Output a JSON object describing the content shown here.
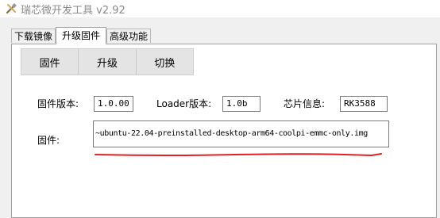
{
  "window": {
    "title": "瑞芯微开发工具 v2.92",
    "icon": "tools-icon"
  },
  "tabs": [
    {
      "label": "下载镜像",
      "active": false
    },
    {
      "label": "升级固件",
      "active": true
    },
    {
      "label": "高级功能",
      "active": false
    }
  ],
  "toolbar": {
    "firmware_label": "固件",
    "upgrade_label": "升级",
    "switch_label": "切换"
  },
  "info": {
    "fw_version_label": "固件版本:",
    "fw_version_value": "1.0.00",
    "loader_version_label": "Loader版本:",
    "loader_version_value": "1.0b",
    "chip_info_label": "芯片信息:",
    "chip_info_value": "RK3588"
  },
  "firmware": {
    "label": "固件:",
    "path": "~ubuntu-22.04-preinstalled-desktop-arm64-coolpi-emmc-only.img"
  },
  "annotation": {
    "underline_color": "#e02020"
  }
}
